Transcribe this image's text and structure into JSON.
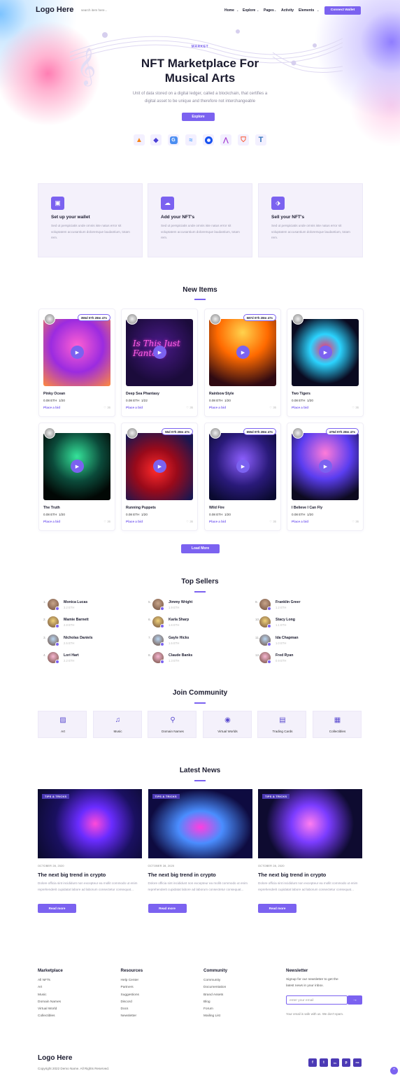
{
  "header": {
    "logo": "Logo Here",
    "search_placeholder": "search item here...",
    "nav": [
      "Home",
      "Explore",
      "Pages",
      "Activity",
      "Elements"
    ],
    "connect": "Connect Wallet"
  },
  "hero": {
    "tag": "MARKET",
    "title_line1": "NFT Marketplace For",
    "title_line2": "Musical Arts",
    "subtitle_line1": "Unit of data stored on a digital ledger, called a blockchain, that certifies a",
    "subtitle_line2": "digital asset to be unique and therefore not interchangeable",
    "cta": "Explore"
  },
  "wallets": [
    "metamask-icon",
    "kyber-icon",
    "gnosis-icon",
    "walletconnect-icon",
    "coinbase-icon",
    "arbitrum-icon",
    "brave-icon",
    "trust-icon"
  ],
  "steps": [
    {
      "title": "Set up your wallet",
      "desc": "Sed ut perspiciatis unde omnis iste natus error sit voluptatem accusantium doloremque laudantium, totam rem."
    },
    {
      "title": "Add your NFT's",
      "desc": "Sed ut perspiciatis unde omnis iste natus error sit voluptatem accusantium doloremque laudantium, totam rem."
    },
    {
      "title": "Sell your NFT's",
      "desc": "Sed ut perspiciatis unde omnis iste natus error sit voluptatem accusantium doloremque laudantium, totam rem."
    }
  ],
  "new_items": {
    "heading": "New Items",
    "load_more": "Load More",
    "bid_label": "Place a bid",
    "like": "36",
    "items": [
      {
        "name": "Pinky Ocean",
        "price": "0.08 ETH",
        "qty": "1/20",
        "timer": "355d 07h 28m 47s"
      },
      {
        "name": "Deep Sea Phantasy",
        "price": "0.08 ETH",
        "qty": "1/22",
        "timer": ""
      },
      {
        "name": "Rainbow Style",
        "price": "0.08 ETH",
        "qty": "1/20",
        "timer": "587d 07h 28m 47s"
      },
      {
        "name": "Two Tigers",
        "price": "0.08 ETH",
        "qty": "1/20",
        "timer": ""
      },
      {
        "name": "The Truth",
        "price": "0.08 ETH",
        "qty": "1/20",
        "timer": ""
      },
      {
        "name": "Running Puppets",
        "price": "0.08 ETH",
        "qty": "1/20",
        "timer": "55d 07h 28m 47s"
      },
      {
        "name": "Wild Fire",
        "price": "0.08 ETH",
        "qty": "1/20",
        "timer": "655d 07h 28m 47s"
      },
      {
        "name": "I Believe I Can Fly",
        "price": "0.08 ETH",
        "qty": "1/20",
        "timer": "475d 07h 28m 47s"
      }
    ]
  },
  "sellers": {
    "heading": "Top Sellers",
    "list": [
      {
        "n": "1.",
        "name": "Monica Lucas",
        "eth": "3.2 ETH"
      },
      {
        "n": "2.",
        "name": "Mamie Barnett",
        "eth": "2.8 ETH"
      },
      {
        "n": "3.",
        "name": "Nicholas Daniels",
        "eth": "2.5 ETH"
      },
      {
        "n": "4.",
        "name": "Lori Hart",
        "eth": "2.2 ETH"
      },
      {
        "n": "5.",
        "name": "Jimmy Wright",
        "eth": "1.9 ETH"
      },
      {
        "n": "6.",
        "name": "Karla Sharp",
        "eth": "1.6 ETH"
      },
      {
        "n": "7.",
        "name": "Gayle Hicks",
        "eth": "1.5 ETH"
      },
      {
        "n": "8.",
        "name": "Claude Banks",
        "eth": "1.3 ETH"
      },
      {
        "n": "9.",
        "name": "Franklin Greer",
        "eth": "1.2 ETH"
      },
      {
        "n": "10.",
        "name": "Stacy Long",
        "eth": "1.1 ETH"
      },
      {
        "n": "11.",
        "name": "Ida Chapman",
        "eth": "1.0 ETH"
      },
      {
        "n": "12.",
        "name": "Fred Ryan",
        "eth": "0.9 ETH"
      }
    ]
  },
  "community": {
    "heading": "Join Community",
    "cats": [
      {
        "label": "Art",
        "icon": "image-icon"
      },
      {
        "label": "Music",
        "icon": "music-icon"
      },
      {
        "label": "Domain Names",
        "icon": "search-icon"
      },
      {
        "label": "Virtual Worlds",
        "icon": "globe-icon"
      },
      {
        "label": "Trading Cards",
        "icon": "card-icon"
      },
      {
        "label": "Collectibles",
        "icon": "grid-icon"
      }
    ]
  },
  "news": {
    "heading": "Latest News",
    "tag": "TIPS & TRICKS",
    "read_more": "Read more",
    "posts": [
      {
        "date": "OCTOBER 28, 2020",
        "title": "The next big trend in crypto",
        "desc": "Dolore officia sint incididunt non excepteur ea mollit commodo ut enim reprehenderit cupidatat labore ad laborum consectetur consequat..."
      },
      {
        "date": "OCTOBER 28, 2020",
        "title": "The next big trend in crypto",
        "desc": "Dolore officia sint incididunt non excepteur ea mollit commodo ut enim reprehenderit cupidatat labore ad laborum consectetur consequat..."
      },
      {
        "date": "OCTOBER 28, 2020",
        "title": "The next big trend in crypto",
        "desc": "Dolore officia sint incididunt non excepteur ea mollit commodo ut enim reprehenderit cupidatat labore ad laborum consectetur consequat..."
      }
    ]
  },
  "footer": {
    "cols": [
      {
        "heading": "Marketplace",
        "items": [
          "All NFTs",
          "Art",
          "Music",
          "Domain Names",
          "Virtual World",
          "Collectibles"
        ]
      },
      {
        "heading": "Resources",
        "items": [
          "Help Center",
          "Partners",
          "Suggestions",
          "Discord",
          "Docs",
          "Newsletter"
        ]
      },
      {
        "heading": "Community",
        "items": [
          "Community",
          "Documentation",
          "Brand Assets",
          "Blog",
          "Forum",
          "Mailing List"
        ]
      }
    ],
    "newsletter": {
      "heading": "Newsletter",
      "text_line1": "Signup for our newsletter to get the",
      "text_line2": "latest news in your inbox.",
      "placeholder": "enter your email",
      "note": "Your email is safe with us. We don't spam."
    },
    "logo": "Logo Here",
    "copyright": "Copyright 2022 Demo Name. All Rights Reserved.",
    "social": [
      "f",
      "t",
      "in",
      "p",
      "rss"
    ]
  },
  "colors": {
    "accent": "#7b62f0",
    "dark": "#1b1b2f",
    "card_bg": "#f4f1fb"
  }
}
